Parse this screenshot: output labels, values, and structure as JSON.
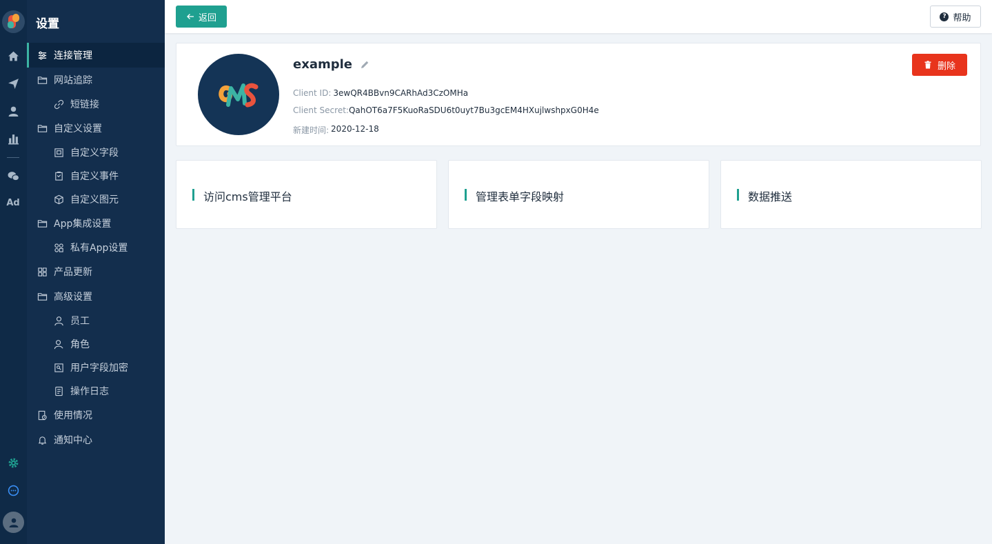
{
  "sidebar": {
    "title": "设置",
    "items": [
      {
        "label": "连接管理",
        "icon": "sliders-icon",
        "level": "top",
        "active": true
      },
      {
        "label": "网站追踪",
        "icon": "folder-icon",
        "level": "top"
      },
      {
        "label": "短链接",
        "icon": "link-icon",
        "level": "sub"
      },
      {
        "label": "自定义设置",
        "icon": "folder-icon",
        "level": "top"
      },
      {
        "label": "自定义字段",
        "icon": "field-icon",
        "level": "sub"
      },
      {
        "label": "自定义事件",
        "icon": "clipboard-icon",
        "level": "sub"
      },
      {
        "label": "自定义图元",
        "icon": "cube-icon",
        "level": "sub"
      },
      {
        "label": "App集成设置",
        "icon": "folder-icon",
        "level": "top"
      },
      {
        "label": "私有App设置",
        "icon": "apps-icon",
        "level": "sub"
      },
      {
        "label": "产品更新",
        "icon": "grid-icon",
        "level": "top"
      },
      {
        "label": "高级设置",
        "icon": "folder-icon",
        "level": "top"
      },
      {
        "label": "员工",
        "icon": "user-icon",
        "level": "sub"
      },
      {
        "label": "角色",
        "icon": "user-role-icon",
        "level": "sub"
      },
      {
        "label": "用户字段加密",
        "icon": "encrypt-icon",
        "level": "sub"
      },
      {
        "label": "操作日志",
        "icon": "log-icon",
        "level": "sub"
      },
      {
        "label": "使用情况",
        "icon": "usage-icon",
        "level": "top"
      },
      {
        "label": "通知中心",
        "icon": "bell-icon",
        "level": "top"
      }
    ]
  },
  "topbar": {
    "back_label": "返回",
    "help_label": "帮助"
  },
  "app": {
    "name": "example",
    "client_id_label": "Client ID:",
    "client_id": "3ewQR4BBvn9CARhAd3CzOMHa",
    "client_secret_label": "Client Secret:",
    "client_secret": "QahOT6a7F5KuoRaSDU6t0uyt7Bu3gcEM4HXujlwshpxG0H4e",
    "created_label": "新建时间:",
    "created": "2020-12-18",
    "delete_label": "删除",
    "avatar_text": "cms"
  },
  "actions": [
    {
      "label": "访问cms管理平台"
    },
    {
      "label": "管理表单字段映射"
    },
    {
      "label": "数据推送"
    }
  ],
  "colors": {
    "accent": "#1fa090",
    "danger": "#e8341c",
    "sidebar_bg": "#132e4d",
    "rail_bg": "#0f2a47"
  }
}
